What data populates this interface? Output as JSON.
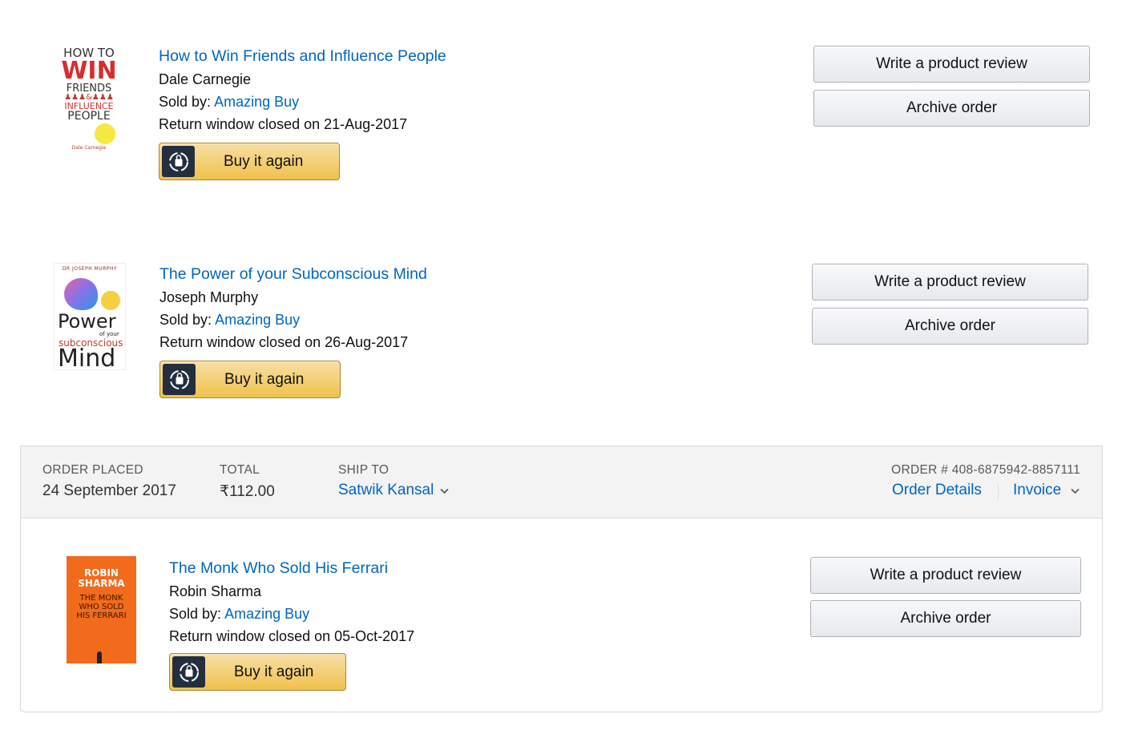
{
  "items": [
    {
      "title": "How to Win Friends and Influence People",
      "author": "Dale Carnegie",
      "sold_by_label": "Sold by:",
      "seller": "Amazing Buy",
      "return_text": "Return window closed on 21-Aug-2017",
      "buy_again_label": "Buy it again",
      "review_label": "Write a product review",
      "archive_label": "Archive order",
      "cover": {
        "line1": "HOW TO",
        "line2": "WIN",
        "line3": "FRIENDS",
        "line4": "INFLUENCE",
        "line5": "PEOPLE",
        "author": "Dale Carnegie"
      }
    },
    {
      "title": "The Power of your Subconscious Mind",
      "author": "Joseph Murphy",
      "sold_by_label": "Sold by:",
      "seller": "Amazing Buy",
      "return_text": "Return window closed on 26-Aug-2017",
      "buy_again_label": "Buy it again",
      "review_label": "Write a product review",
      "archive_label": "Archive order",
      "cover": {
        "top": "DR JOSEPH MURPHY",
        "line1": "Power",
        "line2": "of your",
        "line3": "subconscious",
        "line4": "Mind"
      }
    }
  ],
  "order": {
    "placed_label": "ORDER PLACED",
    "placed_value": "24 September 2017",
    "total_label": "TOTAL",
    "total_value": "₹112.00",
    "ship_label": "SHIP TO",
    "ship_value": "Satwik Kansal",
    "order_number": "ORDER # 408-6875942-8857111",
    "details_label": "Order Details",
    "invoice_label": "Invoice",
    "item": {
      "title": "The Monk Who Sold His Ferrari",
      "author": "Robin Sharma",
      "sold_by_label": "Sold by:",
      "seller": "Amazing Buy",
      "return_text": "Return window closed on 05-Oct-2017",
      "buy_again_label": "Buy it again",
      "review_label": "Write a product review",
      "archive_label": "Archive order",
      "cover": {
        "line1": "ROBIN",
        "line2": "SHARMA",
        "line3": "THE MONK",
        "line4": "WHO SOLD",
        "line5": "HIS FERRARI"
      }
    }
  },
  "colors": {
    "link": "#0066c0",
    "buy_button": "#f0c14b",
    "header_bg": "#f3f3f3"
  },
  "icons": {
    "buy_again": "reorder-bag-icon",
    "dropdown": "chevron-down-icon"
  }
}
